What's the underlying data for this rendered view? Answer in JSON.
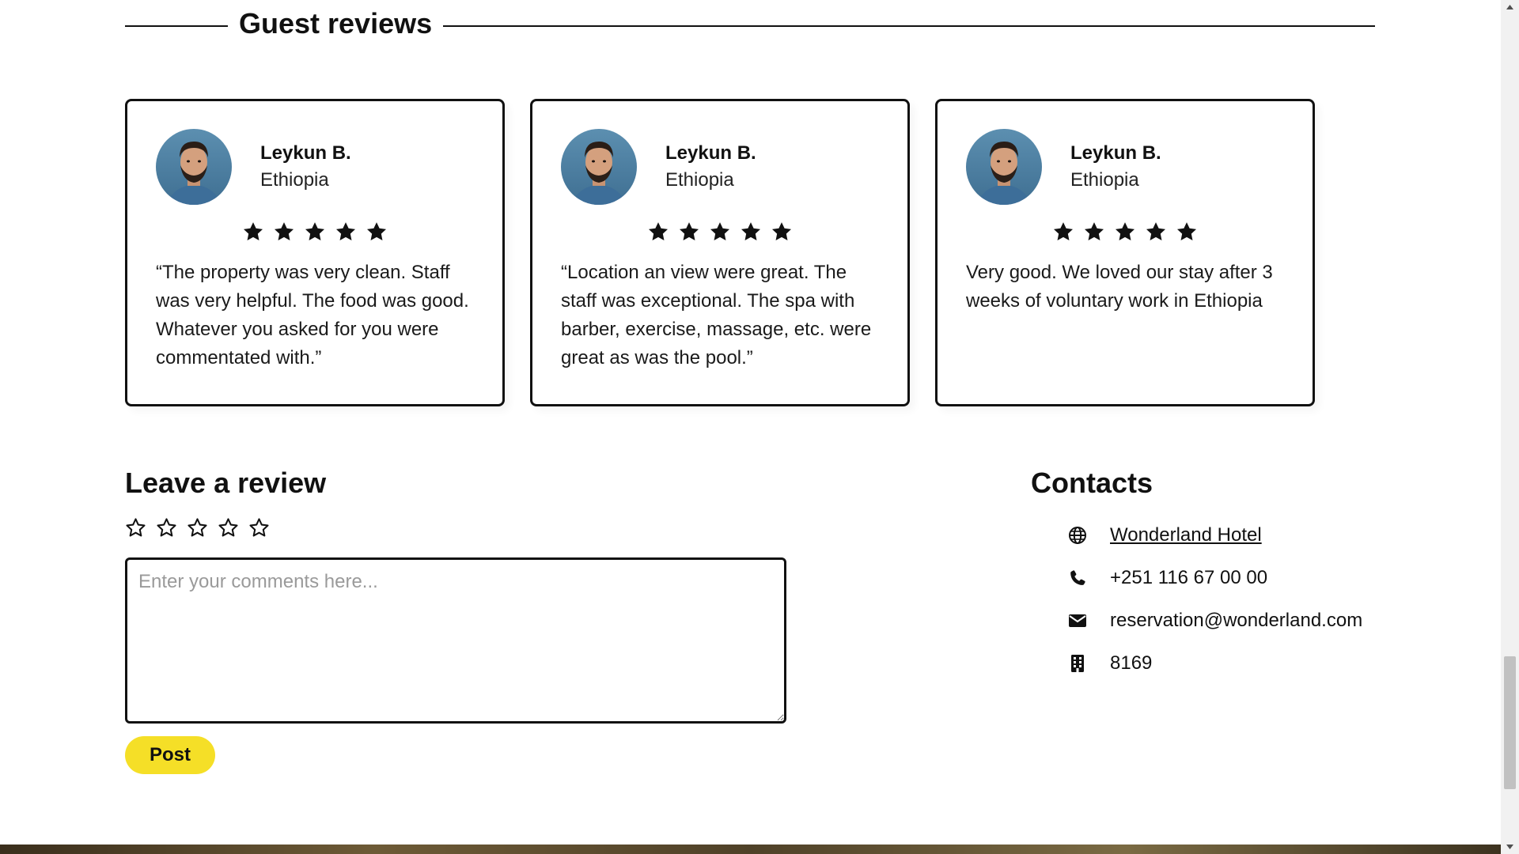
{
  "section": {
    "title": "Guest reviews"
  },
  "reviews": [
    {
      "name": "Leykun B.",
      "country": "Ethiopia",
      "rating": 5,
      "text": "“The property was very clean. Staff was very helpful. The food was good. Whatever you asked for you were commentated with.”"
    },
    {
      "name": "Leykun B.",
      "country": "Ethiopia",
      "rating": 5,
      "text": "“Location an view were great. The staff was exceptional. The spa with barber, exercise, massage, etc. were great as was the pool.”"
    },
    {
      "name": "Leykun B.",
      "country": "Ethiopia",
      "rating": 5,
      "text": "Very good. We loved our stay after 3 weeks of voluntary work in Ethiopia"
    }
  ],
  "leave_review": {
    "title": "Leave a review",
    "star_count": 5,
    "comment_placeholder": "Enter your comments here...",
    "comment_value": "",
    "post_label": "Post"
  },
  "contacts": {
    "title": "Contacts",
    "items": [
      {
        "icon": "globe-icon",
        "text": "Wonderland Hotel",
        "link": true
      },
      {
        "icon": "phone-icon",
        "text": "+251 116 67 00 00"
      },
      {
        "icon": "envelope-icon",
        "text": "reservation@wonderland.com"
      },
      {
        "icon": "building-icon",
        "text": "8169"
      }
    ]
  },
  "colors": {
    "accent_yellow": "#f5df27",
    "text": "#111111",
    "border": "#111111",
    "placeholder": "#9a9a9a"
  }
}
